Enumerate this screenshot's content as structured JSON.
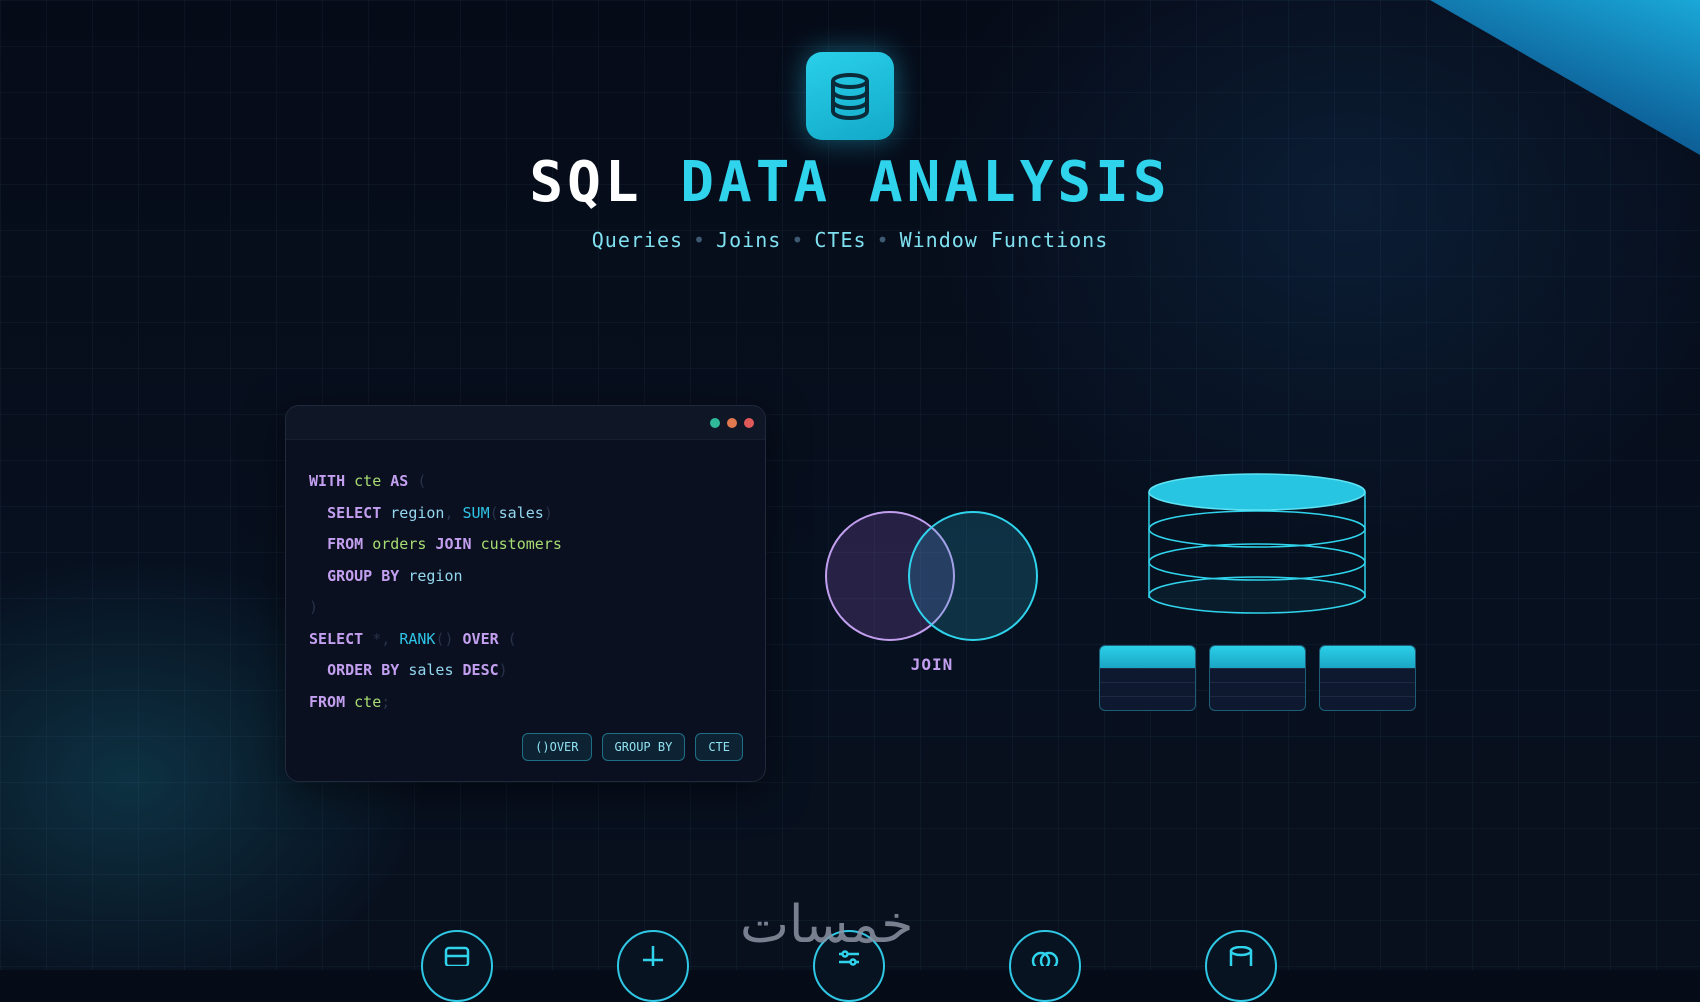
{
  "header": {
    "logo_icon": "database-icon",
    "title_part1": "SQL",
    "title_part2": "DATA ANALYSIS",
    "subtitle": [
      "Queries",
      "Joins",
      "CTEs",
      "Window Functions"
    ],
    "subtitle_separator": "•"
  },
  "colors": {
    "accent": "#2fd3ec",
    "keyword": "#c39ff0",
    "table": "#a6dc72",
    "background": "#060b18"
  },
  "editor": {
    "window_dots": [
      "#2fb89a",
      "#e0794f",
      "#e05a5a"
    ],
    "code_lines": [
      [
        [
          "kw",
          "WITH"
        ],
        [
          "pn",
          " "
        ],
        [
          "tb",
          "cte"
        ],
        [
          "pn",
          " "
        ],
        [
          "kw",
          "AS"
        ],
        [
          "pn",
          " ("
        ]
      ],
      [
        [
          "pn",
          "  "
        ],
        [
          "kw",
          "SELECT"
        ],
        [
          "pn",
          " "
        ],
        [
          "id",
          "region"
        ],
        [
          "pn",
          ", "
        ],
        [
          "fn",
          "SUM"
        ],
        [
          "pn",
          "("
        ],
        [
          "id",
          "sales"
        ],
        [
          "pn",
          ")"
        ]
      ],
      [
        [
          "pn",
          "  "
        ],
        [
          "kw",
          "FROM"
        ],
        [
          "pn",
          " "
        ],
        [
          "tb",
          "orders"
        ],
        [
          "pn",
          " "
        ],
        [
          "kw",
          "JOIN"
        ],
        [
          "pn",
          " "
        ],
        [
          "tb",
          "customers"
        ]
      ],
      [
        [
          "pn",
          "  "
        ],
        [
          "kw",
          "GROUP BY"
        ],
        [
          "pn",
          " "
        ],
        [
          "id",
          "region"
        ]
      ],
      [
        [
          "pn",
          ")"
        ]
      ],
      [
        [
          "kw",
          "SELECT"
        ],
        [
          "pn",
          " *, "
        ],
        [
          "fn",
          "RANK"
        ],
        [
          "pn",
          "() "
        ],
        [
          "kw",
          "OVER"
        ],
        [
          "pn",
          " ("
        ]
      ],
      [
        [
          "pn",
          "  "
        ],
        [
          "kw",
          "ORDER BY"
        ],
        [
          "pn",
          " "
        ],
        [
          "id",
          "sales"
        ],
        [
          "pn",
          " "
        ],
        [
          "kw",
          "DESC"
        ],
        [
          "pn",
          ")"
        ]
      ],
      [
        [
          "kw",
          "FROM"
        ],
        [
          "pn",
          " "
        ],
        [
          "tb",
          "cte"
        ],
        [
          "pn",
          ";"
        ]
      ]
    ],
    "tags": [
      "()OVER",
      "GROUP BY",
      "CTE"
    ]
  },
  "venn": {
    "label": "JOIN"
  },
  "bottom_icons": [
    "database-icon",
    "plus-icon",
    "sliders-icon",
    "venn-icon",
    "database-icon"
  ],
  "watermark": "خمسات"
}
